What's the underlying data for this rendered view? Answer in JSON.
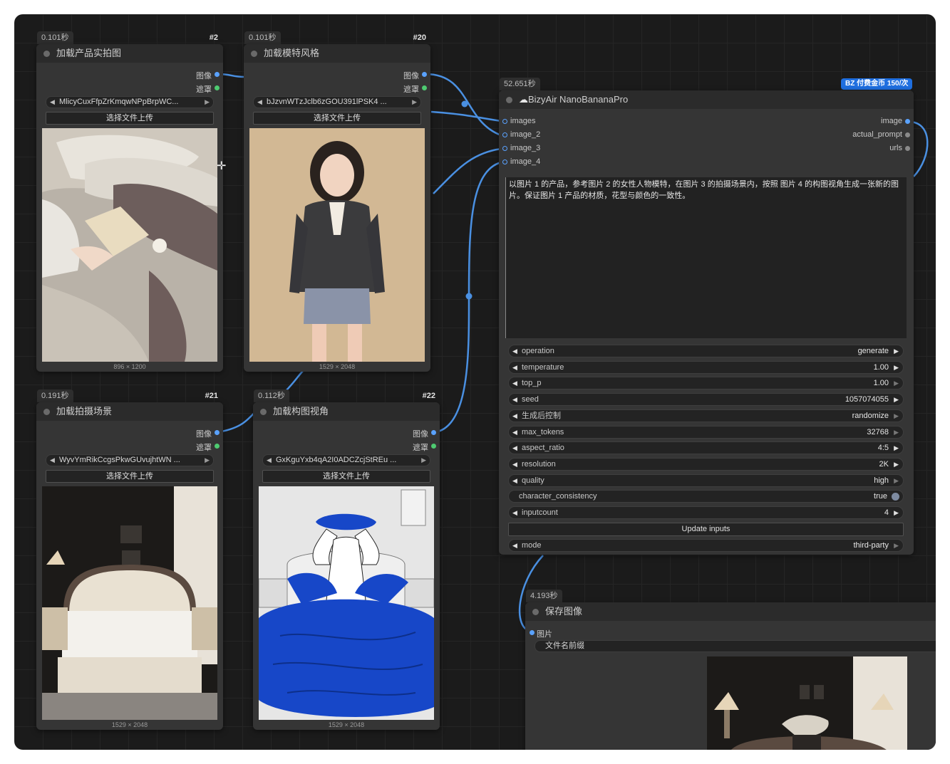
{
  "nodes": {
    "n2": {
      "time": "0.101秒",
      "id": "#2",
      "title": "加载产品实拍图",
      "outputs": [
        "图像",
        "遮罩"
      ],
      "file": "MlicyCuxFfpZrKmqwNPpBrpWC...",
      "upload": "选择文件上传",
      "dims": "896 × 1200"
    },
    "n20": {
      "time": "0.101秒",
      "id": "#20",
      "title": "加载模特风格",
      "outputs": [
        "图像",
        "遮罩"
      ],
      "file": "bJzvnWTzJclb6zGOU391lPSK4 ...",
      "upload": "选择文件上传",
      "dims": "1529 × 2048"
    },
    "n21": {
      "time": "0.191秒",
      "id": "#21",
      "title": "加载拍摄场景",
      "outputs": [
        "图像",
        "遮罩"
      ],
      "file": "WyvYmRikCcgsPkwGUvujhtWN ...",
      "upload": "选择文件上传",
      "dims": "1529 × 2048"
    },
    "n22": {
      "time": "0.112秒",
      "id": "#22",
      "title": "加载构图视角",
      "outputs": [
        "图像",
        "遮罩"
      ],
      "file": "GxKguYxb4qA2I0ADCZcjStREu ...",
      "upload": "选择文件上传",
      "dims": "1529 × 2048"
    },
    "nano": {
      "time": "52.651秒",
      "badge": "BZ 付费金币 150/次",
      "title": "BizyAir NanoBananaPro",
      "inputs": [
        "images",
        "image_2",
        "image_3",
        "image_4"
      ],
      "outputs": [
        "image",
        "actual_prompt",
        "urls"
      ],
      "prompt": "以图片 1 的产品，参考图片 2 的女性人物模特，在图片 3 的拍摄场景内，按照 图片 4 的构图视角生成一张新的图片。保证图片 1 产品的材质，花型与颜色的一致性。",
      "widgets": [
        {
          "label": "operation",
          "value": "generate"
        },
        {
          "label": "temperature",
          "value": "1.00"
        },
        {
          "label": "top_p",
          "value": "1.00"
        },
        {
          "label": "seed",
          "value": "1057074055"
        },
        {
          "label": "生成后控制",
          "value": "randomize"
        },
        {
          "label": "max_tokens",
          "value": "32768"
        },
        {
          "label": "aspect_ratio",
          "value": "4:5"
        },
        {
          "label": "resolution",
          "value": "2K"
        },
        {
          "label": "quality",
          "value": "high"
        },
        {
          "label": "character_consistency",
          "value": "true"
        },
        {
          "label": "inputcount",
          "value": "4"
        }
      ],
      "update_button": "Update inputs",
      "mode": {
        "label": "mode",
        "value": "third-party"
      }
    },
    "save": {
      "time": "4.193秒",
      "title": "保存图像",
      "input": "图片",
      "prefix_label": "文件名前缀"
    }
  },
  "colors": {
    "link": "#4a90e2",
    "socket_image": "#5aa2ff",
    "socket_mask": "#4ecb71",
    "pay_badge": "#1f6fe0",
    "canvas": "#1b1b1b",
    "node": "#353535"
  }
}
